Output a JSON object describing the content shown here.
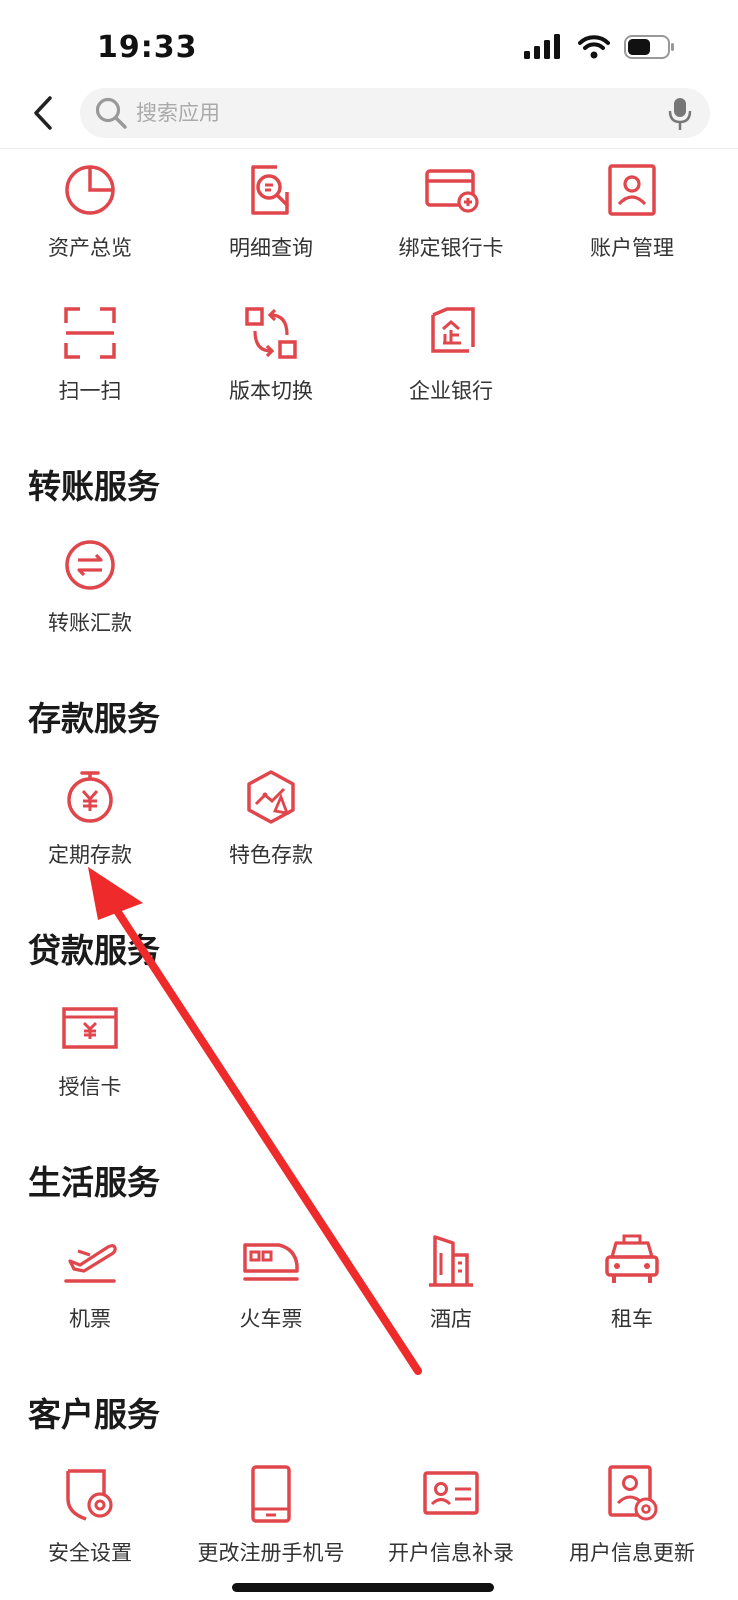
{
  "status_bar": {
    "time": "19:33"
  },
  "search": {
    "placeholder": "搜索应用"
  },
  "top_grid": [
    {
      "label": "资产总览",
      "icon": "pie-chart-icon"
    },
    {
      "label": "明细查询",
      "icon": "document-search-icon"
    },
    {
      "label": "绑定银行卡",
      "icon": "add-card-icon"
    },
    {
      "label": "账户管理",
      "icon": "user-profile-icon"
    },
    {
      "label": "扫一扫",
      "icon": "scan-icon"
    },
    {
      "label": "版本切换",
      "icon": "switch-icon"
    },
    {
      "label": "企业银行",
      "icon": "enterprise-icon"
    }
  ],
  "sections": {
    "transfer": {
      "title": "转账服务",
      "items": [
        {
          "label": "转账汇款",
          "icon": "transfer-icon"
        }
      ]
    },
    "deposit": {
      "title": "存款服务",
      "items": [
        {
          "label": "定期存款",
          "icon": "stopwatch-yuan-icon"
        },
        {
          "label": "特色存款",
          "icon": "trend-hexagon-icon"
        }
      ]
    },
    "loan": {
      "title": "贷款服务",
      "items": [
        {
          "label": "授信卡",
          "icon": "yuan-card-icon"
        }
      ]
    },
    "life": {
      "title": "生活服务",
      "items": [
        {
          "label": "机票",
          "icon": "airplane-icon"
        },
        {
          "label": "火车票",
          "icon": "train-icon"
        },
        {
          "label": "酒店",
          "icon": "hotel-icon"
        },
        {
          "label": "租车",
          "icon": "taxi-icon"
        }
      ]
    },
    "customer": {
      "title": "客户服务",
      "items": [
        {
          "label": "安全设置",
          "icon": "shield-gear-icon"
        },
        {
          "label": "更改注册手机号",
          "icon": "phone-icon"
        },
        {
          "label": "开户信息补录",
          "icon": "id-card-icon"
        },
        {
          "label": "用户信息更新",
          "icon": "user-gear-icon"
        }
      ]
    }
  },
  "colors": {
    "accent": "#e0474c",
    "annotation_arrow": "#ee2a2a"
  }
}
